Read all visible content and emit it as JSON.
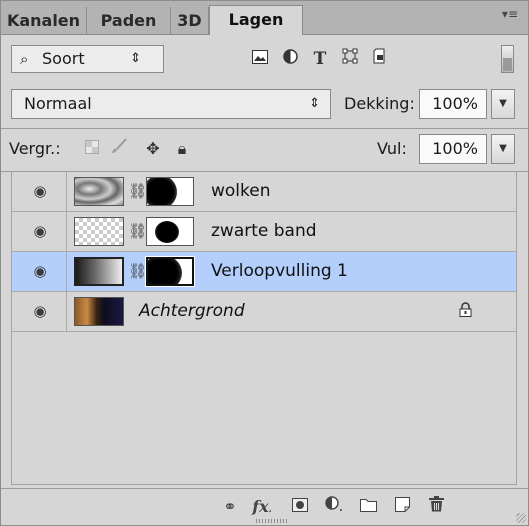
{
  "tabs": [
    {
      "label": "Kanalen",
      "active": false
    },
    {
      "label": "Paden",
      "active": false
    },
    {
      "label": "3D",
      "active": false
    },
    {
      "label": "Lagen",
      "active": true
    }
  ],
  "filter": {
    "kind_label": "Soort",
    "icons": [
      "image-filter-icon",
      "adjustment-filter-icon",
      "type-filter-icon",
      "shape-filter-icon",
      "smart-object-filter-icon"
    ],
    "type_glyph": "T"
  },
  "blend": {
    "mode": "Normaal",
    "opacity_label": "Dekking:",
    "opacity_value": "100%"
  },
  "lock": {
    "label": "Vergr.:",
    "fill_label": "Vul:",
    "fill_value": "100%"
  },
  "layers": [
    {
      "name": "wolken",
      "selected": false,
      "italic": false
    },
    {
      "name": "zwarte band",
      "selected": false,
      "italic": false
    },
    {
      "name": "Verloopvulling 1",
      "selected": true,
      "italic": false
    },
    {
      "name": "Achtergrond",
      "selected": false,
      "italic": true,
      "locked": true
    }
  ],
  "bottom_icons": [
    "link-icon",
    "fx-icon",
    "add-mask-icon",
    "adjustment-layer-icon",
    "new-group-icon",
    "new-layer-icon",
    "delete-icon"
  ],
  "fx_label": "fx",
  "colors": {
    "selected_row": "#b4cffb",
    "panel_bg": "#d6d6d6"
  }
}
